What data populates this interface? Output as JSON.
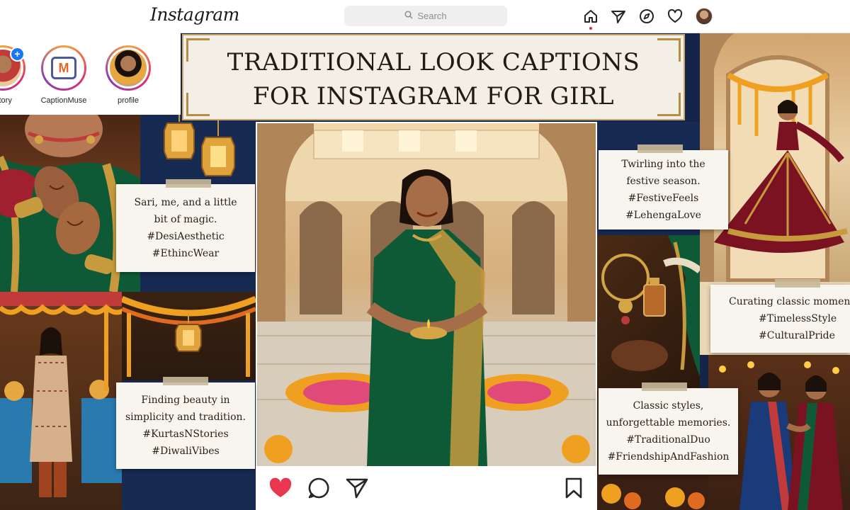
{
  "header": {
    "logo": "Instagram",
    "search_placeholder": "Search",
    "nav_icons": [
      "home-icon",
      "send-icon",
      "explore-icon",
      "heart-icon",
      "avatar"
    ]
  },
  "stories": [
    {
      "label": "Story"
    },
    {
      "label": "CaptionMuse",
      "logo_letter": "M"
    },
    {
      "label": "profile"
    }
  ],
  "title": {
    "line1": "TRADITIONAL LOOK CAPTIONS",
    "line2": "FOR INSTAGRAM FOR GIRL"
  },
  "cards": [
    {
      "lines": [
        "Sari, me, and a little",
        "bit of magic.",
        "#DesiAesthetic",
        "#EthincWear"
      ]
    },
    {
      "lines": [
        "Finding beauty in",
        "simplicity and tradition.",
        "#KurtasNStories",
        "#DiwaliVibes"
      ]
    },
    {
      "lines": [
        "Twirling into the",
        "festive season.",
        "#FestiveFeels",
        "#LehengaLove"
      ]
    },
    {
      "lines": [
        "Curating classic momen",
        "#TimelessStyle",
        "#CulturalPride"
      ]
    },
    {
      "lines": [
        "Classic styles,",
        "unforgettable memories.",
        "#TraditionalDuo",
        "#FriendshipAndFashion"
      ]
    }
  ],
  "post_actions": [
    "like-icon",
    "comment-icon",
    "share-icon",
    "save-icon"
  ],
  "colors": {
    "like": "#e8374f",
    "navy": "#15254a",
    "saree_green": "#0f5a36",
    "gold": "#c79a3e",
    "maroon": "#7a1222"
  }
}
